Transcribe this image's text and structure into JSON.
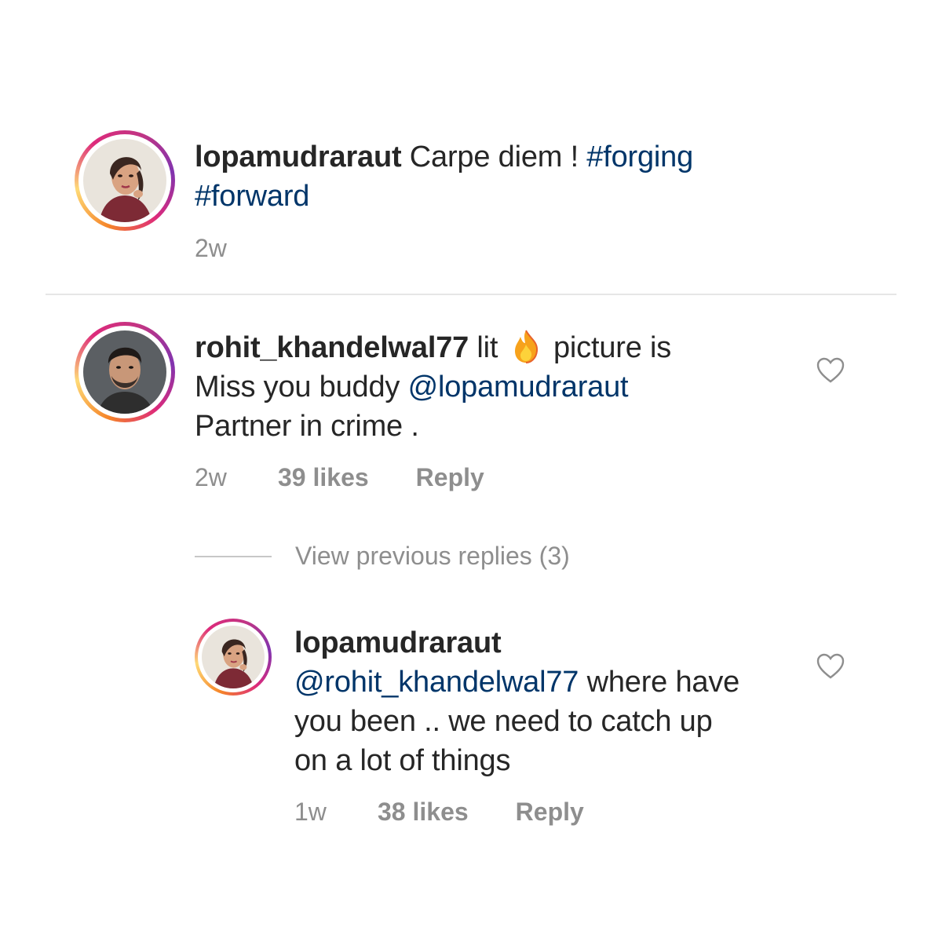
{
  "caption": {
    "username": "lopamudraraut",
    "text": " Carpe diem ! ",
    "hashtag1": "#forging",
    "hashtag2": "#forward",
    "time": "2w"
  },
  "comment": {
    "username": "rohit_khandelwal77",
    "text_a": " lit ",
    "emoji": "fire-emoji",
    "text_b": " picture is",
    "line2_a": "Miss you buddy ",
    "mention": "@lopamudraraut",
    "line3": "Partner in crime .",
    "time": "2w",
    "likes": "39 likes",
    "reply": "Reply"
  },
  "view_replies": "View previous replies (3)",
  "reply": {
    "username": "lopamudraraut",
    "mention": "@rohit_khandelwal77",
    "text_a": " where have",
    "line2": "you been .. we need to catch up",
    "line3": "on a lot of things",
    "time": "1w",
    "likes": "38 likes",
    "reply": "Reply"
  },
  "colors": {
    "text": "#262626",
    "muted": "#8e8e8e",
    "link": "#003569",
    "divider": "#e6e6e6"
  }
}
